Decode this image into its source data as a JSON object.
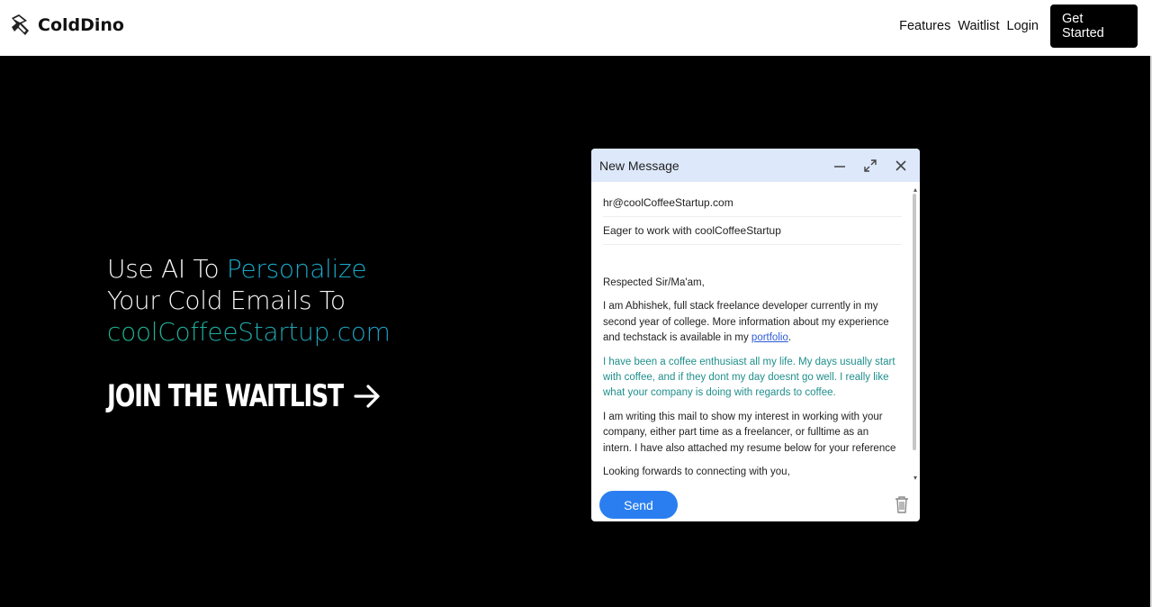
{
  "brand": {
    "name": "ColdDino",
    "icon": "dino-logo-icon"
  },
  "nav": {
    "links": [
      "Features",
      "Waitlist",
      "Login"
    ],
    "cta": "Get Started"
  },
  "hero": {
    "line1_prefix": "Use AI To ",
    "line1_accent": "Personalize",
    "line2": "Your Cold Emails To",
    "line3_accent": "coolCoffeeStartup.com",
    "waitlist_label": "JOIN THE WAITLIST",
    "waitlist_icon": "arrow-right-icon"
  },
  "compose": {
    "title": "New Message",
    "to": "hr@coolCoffeeStartup.com",
    "subject": "Eager to work with coolCoffeeStartup",
    "greeting": "Respected Sir/Ma'am,",
    "para1_text": "I am Abhishek, full stack freelance developer currently in my second year of college. More information about my experience and techstack is available in my ",
    "para1_link": "portfolio",
    "para1_end": ".",
    "para2": "I have been a coffee enthusiast all my life. My days usually start with coffee, and if they dont my day doesnt go well. I really like what your company is doing with regards to coffee.",
    "para3": "I am writing this mail to show my interest in working with your company, either part time as a freelancer, or fulltime as an intern. I have also attached my resume below for your reference",
    "closing": "Looking forwards to connecting with you,",
    "send_label": "Send",
    "icons": [
      "minimize-icon",
      "expand-icon",
      "close-icon",
      "trash-icon"
    ]
  },
  "colors": {
    "accent_green": "#1fb589",
    "accent_blue": "#1f9cc7",
    "compose_header": "#dde8fb",
    "send_button": "#2a7ef0"
  }
}
